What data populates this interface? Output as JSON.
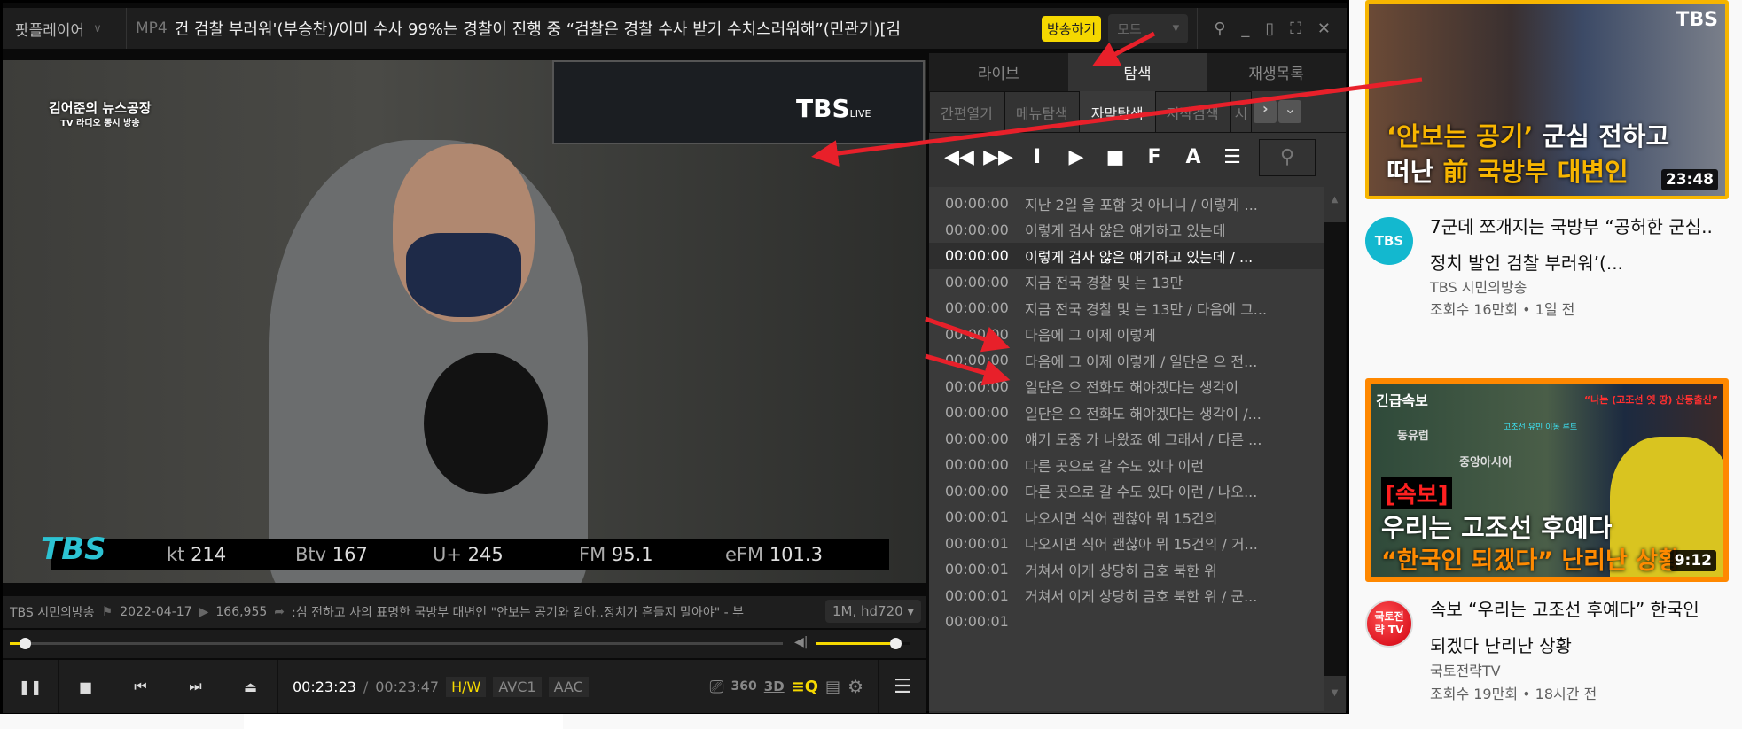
{
  "titlebar": {
    "app": "팟플레이어",
    "app_arrow": "∨",
    "format": "MP4",
    "title": "건 검찰 부러워'(부승찬)/이미 수사 99%는 경찰이 진행 중 “검찰은 경찰 수사 받기 수치스러워해”(민관기)[김",
    "live_button": "방송하기",
    "mode": "모드"
  },
  "video": {
    "show_logo": "김어준의 뉴스공장",
    "show_sub": "TV 라디오 동시 방송",
    "tbs_live": "TBS",
    "live": "LIVE",
    "ticker_logo": "TBS",
    "ticker": [
      {
        "k": "kt",
        "v": "214"
      },
      {
        "k": "Btv",
        "v": "167"
      },
      {
        "k": "U+",
        "v": "245"
      },
      {
        "k": "FM",
        "v": "95.1"
      },
      {
        "k": "eFM",
        "v": "101.3"
      }
    ]
  },
  "info": {
    "channel": "TBS 시민의방송",
    "date": "2022-04-17",
    "views": "166,955",
    "desc": ":심 전하고 사의 표명한 국방부 대변인  \"안보는 공기와 같아..정치가 흔들지 말아야\" - 부",
    "quality": "1M, hd720"
  },
  "playback": {
    "progress": 0.02,
    "volume": 0.85,
    "current": "00:23:23",
    "sep": "/",
    "total": "00:23:47",
    "hw": "H/W",
    "video_codec": "AVC1",
    "audio_codec": "AAC",
    "b360": "360",
    "b3d": "3D"
  },
  "panel": {
    "tabs": [
      "라이브",
      "탐색",
      "재생목록"
    ],
    "subtabs": [
      "간편열기",
      "메뉴탐색",
      "자막탐색",
      "저작검색",
      "시"
    ],
    "tool_letters": [
      "I",
      "F",
      "A"
    ],
    "rows": [
      {
        "t": "00:00:00",
        "s": "지난 2일 을 포함 것 아니니 / 이렇게 ..."
      },
      {
        "t": "00:00:00",
        "s": "이렇게 검사 않은 얘기하고 있는데"
      },
      {
        "t": "00:00:00",
        "s": "이렇게 검사 않은 얘기하고 있는데 / ..."
      },
      {
        "t": "00:00:00",
        "s": "지금 전국 경찰 및 는 13만"
      },
      {
        "t": "00:00:00",
        "s": "지금 전국 경찰 및 는 13만 / 다음에 그..."
      },
      {
        "t": "00:00:00",
        "s": "다음에 그 이제 이렇게"
      },
      {
        "t": "00:00:00",
        "s": "다음에 그 이제 이렇게 / 일단은 으 전..."
      },
      {
        "t": "00:00:00",
        "s": "일단은 으 전화도 해야겠다는 생각이"
      },
      {
        "t": "00:00:00",
        "s": "일단은 으 전화도 해야겠다는 생각이 /..."
      },
      {
        "t": "00:00:00",
        "s": "얘기 도중 가 나왔죠 예 그래서 / 다른 ..."
      },
      {
        "t": "00:00:00",
        "s": "다른 곳으로 갈 수도 있다 이런"
      },
      {
        "t": "00:00:00",
        "s": "다른 곳으로 갈 수도 있다 이런 / 나오..."
      },
      {
        "t": "00:00:01",
        "s": "나오시면 식어 괜찮아 뭐 15건의"
      },
      {
        "t": "00:00:01",
        "s": "나오시면 식어 괜찮아 뭐 15건의 / 거..."
      },
      {
        "t": "00:00:01",
        "s": "거쳐서 이게 상당히 금호 북한 위"
      },
      {
        "t": "00:00:01",
        "s": "거쳐서 이게 상당히 금호 북한 위 / 군..."
      },
      {
        "t": "00:00:01",
        "s": ""
      }
    ]
  },
  "youtube": {
    "videos": [
      {
        "thumb_line1a": "‘안보는 공기’",
        "thumb_line1b": " 군심 전하고",
        "thumb_line2a": "떠난 ",
        "thumb_line2b": "前 국방부 대변인",
        "thumb_brand": "TBS",
        "duration": "23:48",
        "avatar": "TBS",
        "title": "7군데 쪼개지는 국방부 “공허한 군심..정치 발언 검찰 부러워’(...",
        "channel": "TBS 시민의방송",
        "meta": "조회수 16만회 • 1일 전"
      },
      {
        "thumb_tag": "긴급속보",
        "thumb_quote": "“나는 (고조선 옛 땅) 산동출신”",
        "thumb_map1": "동유럽",
        "thumb_map2": "중앙아시아",
        "thumb_route": "고조선 유민 이동 루트",
        "thumb_badge": "[속보]",
        "thumb_line1": "우리는 고조선 후예다",
        "thumb_line2": "“한국인 되겠다” 난리난 상황",
        "duration": "9:12",
        "avatar": "국토전략 TV",
        "title": "속보 “우리는 고조선 후예다” 한국인 되겠다 난리난 상황",
        "channel": "국토전략TV",
        "meta": "조회수 19만회 • 18시간 전"
      }
    ]
  },
  "colors": {
    "accent": "#f5d800",
    "annotation": "#e8202a",
    "tbs": "#1ab8d0"
  }
}
